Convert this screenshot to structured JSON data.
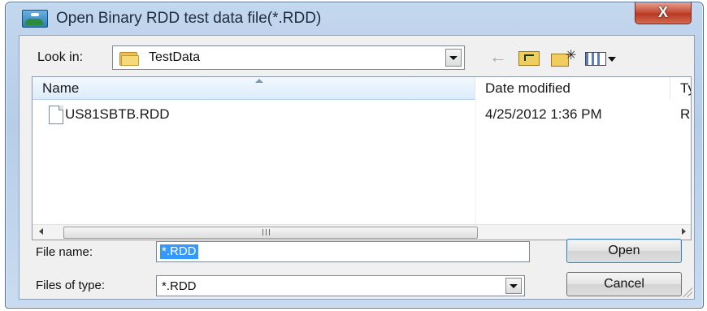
{
  "window": {
    "title": "Open Binary RDD test data file(*.RDD)",
    "close_label": "X",
    "app_icon": "landscape-icon"
  },
  "toolbar": {
    "lookin_label": "Look in:",
    "lookin_value": "TestData",
    "icons": [
      "back-arrow-icon",
      "up-one-level-icon",
      "new-folder-icon",
      "view-menu-icon"
    ]
  },
  "file_list": {
    "columns": [
      "Name",
      "Date modified",
      "Ty"
    ],
    "rows": [
      {
        "name": "US81SBTB.RDD",
        "date_modified": "4/25/2012 1:36 PM",
        "type": "RI"
      }
    ]
  },
  "file_name": {
    "label": "File name:",
    "value": "*.RDD"
  },
  "file_type": {
    "label": "Files of type:",
    "value": "*.RDD"
  },
  "buttons": {
    "open": "Open",
    "cancel": "Cancel"
  }
}
